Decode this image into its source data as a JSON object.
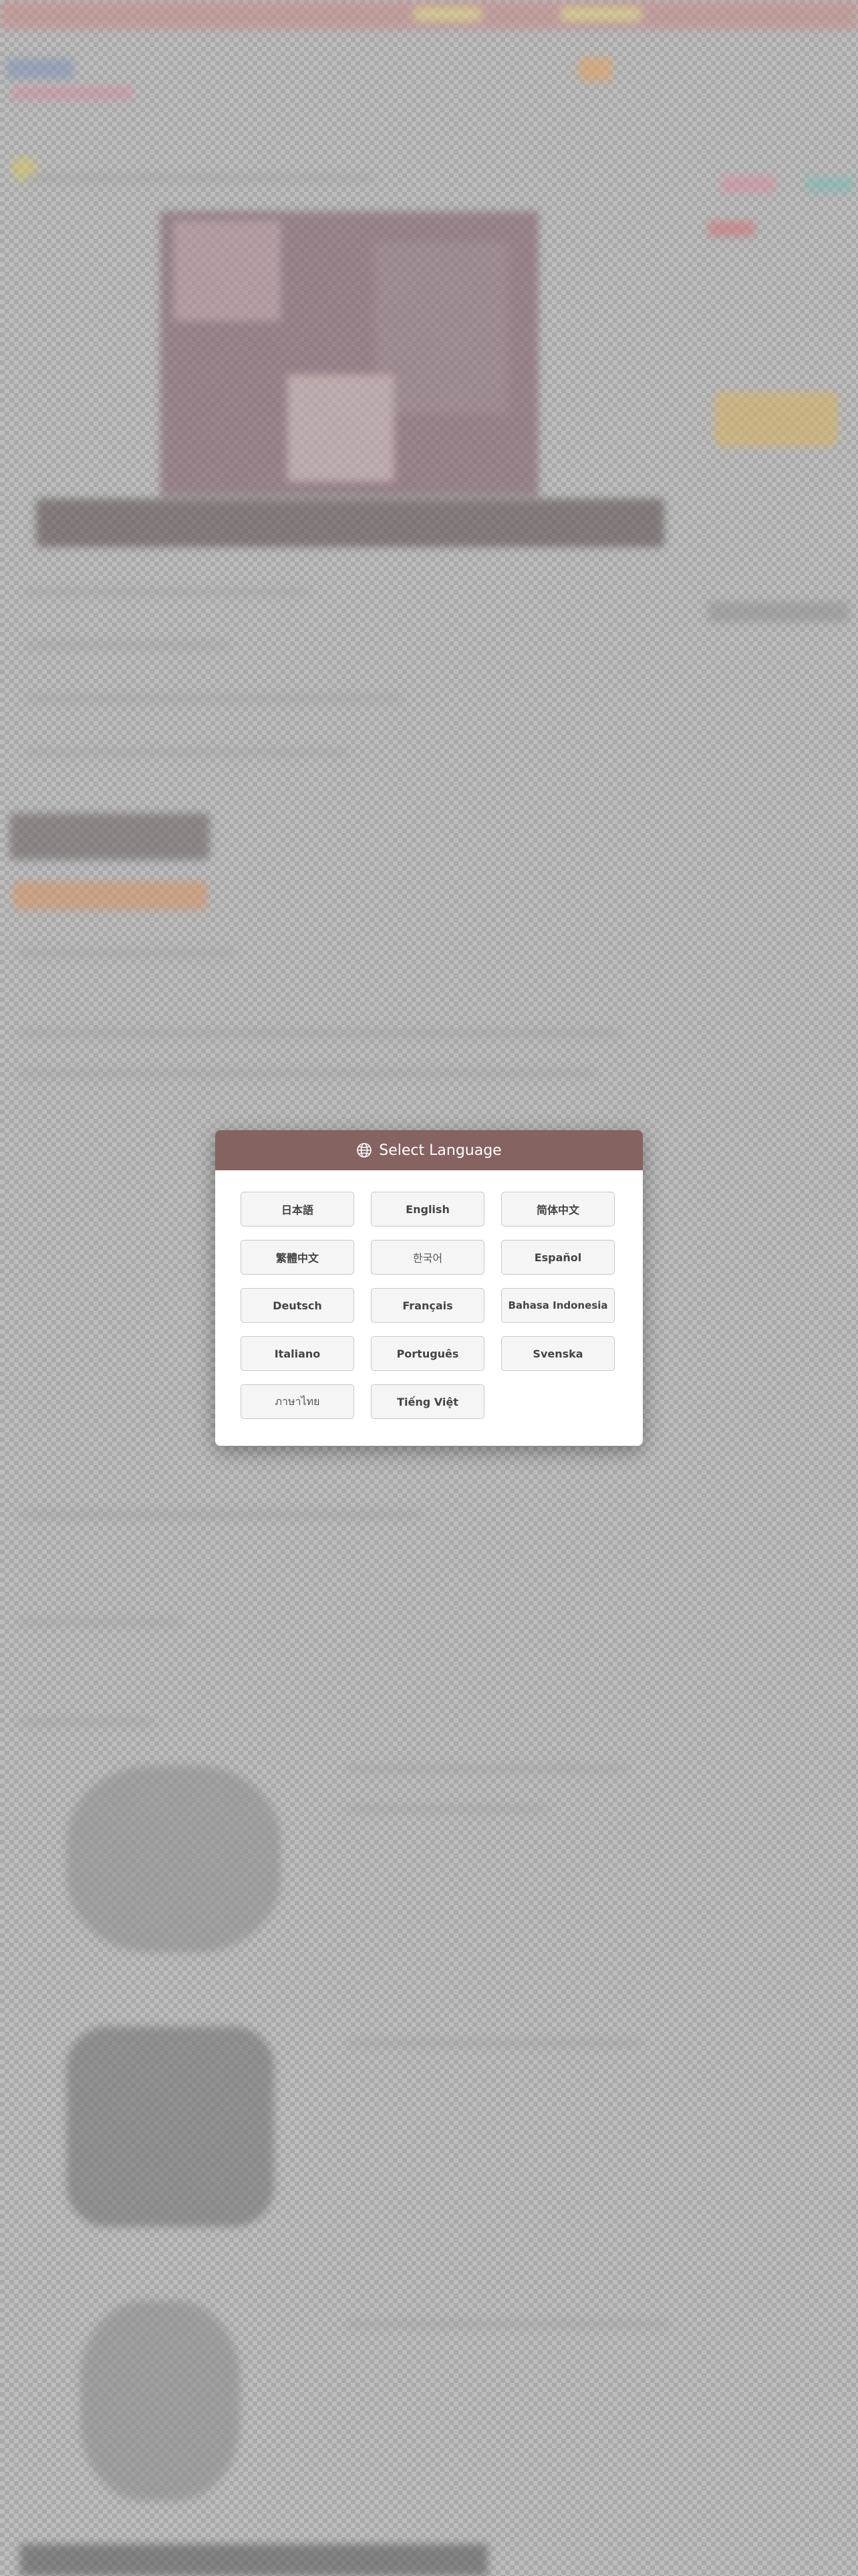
{
  "modal": {
    "title": "Select Language",
    "icon": "globe-icon",
    "header_color": "#856360",
    "languages": [
      {
        "label": "日本語"
      },
      {
        "label": "English"
      },
      {
        "label": "简体中文"
      },
      {
        "label": "繁體中文"
      },
      {
        "label": "한국어"
      },
      {
        "label": "Español"
      },
      {
        "label": "Deutsch"
      },
      {
        "label": "Français"
      },
      {
        "label": "Bahasa Indonesia"
      },
      {
        "label": "Italiano"
      },
      {
        "label": "Português"
      },
      {
        "label": "Svenska"
      },
      {
        "label": "ภาษาไทย"
      },
      {
        "label": "Tiếng Việt"
      }
    ]
  }
}
